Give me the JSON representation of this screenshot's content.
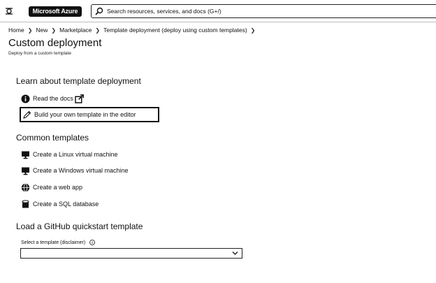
{
  "header": {
    "brand": "Microsoft Azure",
    "search_placeholder": "Search resources, services, and docs (G+/)"
  },
  "breadcrumb": [
    "Home",
    "New",
    "Marketplace",
    "Template deployment (deploy using custom templates)"
  ],
  "page": {
    "title": "Custom deployment",
    "subtitle": "Deploy from a custom template"
  },
  "learn": {
    "heading": "Learn about template deployment",
    "read_docs": "Read the docs",
    "build_own": "Build your own template in the editor"
  },
  "common": {
    "heading": "Common templates",
    "items": [
      {
        "label": "Create a Linux virtual machine",
        "icon": "monitor-icon"
      },
      {
        "label": "Create a Windows virtual machine",
        "icon": "monitor-icon"
      },
      {
        "label": "Create a web app",
        "icon": "globe-icon"
      },
      {
        "label": "Create a SQL database",
        "icon": "database-icon"
      }
    ]
  },
  "github": {
    "heading": "Load a GitHub quickstart template",
    "select_label": "Select a template (disclaimer)",
    "select_value": ""
  }
}
